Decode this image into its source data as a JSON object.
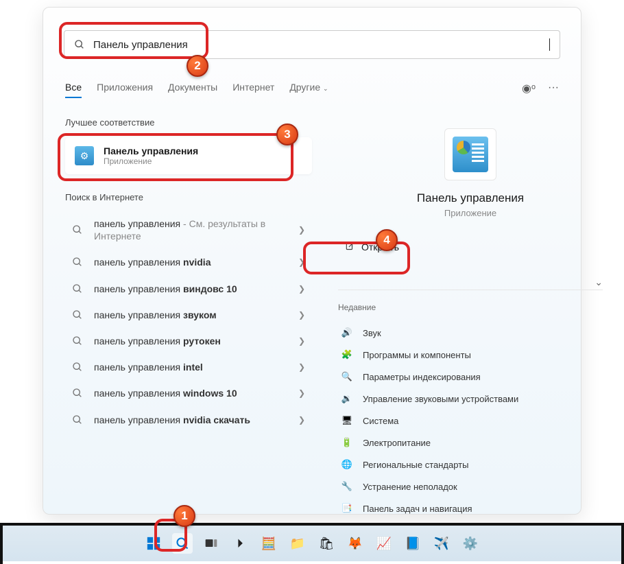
{
  "search": {
    "value": "Панель управления"
  },
  "tabs": {
    "all": "Все",
    "apps": "Приложения",
    "docs": "Документы",
    "web": "Интернет",
    "more": "Другие"
  },
  "left": {
    "best_label": "Лучшее соответствие",
    "best_title": "Панель управления",
    "best_sub": "Приложение",
    "web_label": "Поиск в Интернете",
    "items": [
      {
        "pre": "панель управления",
        "hl": "",
        "sub": " - См. результаты в Интернете"
      },
      {
        "pre": "панель управления ",
        "hl": "nvidia",
        "sub": ""
      },
      {
        "pre": "панель управления ",
        "hl": "виндовс 10",
        "sub": ""
      },
      {
        "pre": "панель управления ",
        "hl": "звуком",
        "sub": ""
      },
      {
        "pre": "панель управления ",
        "hl": "рутокен",
        "sub": ""
      },
      {
        "pre": "панель управления ",
        "hl": "intel",
        "sub": ""
      },
      {
        "pre": "панель управления ",
        "hl": "windows 10",
        "sub": ""
      },
      {
        "pre": "панель управления ",
        "hl": "nvidia скачать",
        "sub": ""
      }
    ]
  },
  "right": {
    "title": "Панель управления",
    "sub": "Приложение",
    "open": "Открыть",
    "recent_label": "Недавние",
    "recent": [
      {
        "icon": "🔊",
        "label": "Звук"
      },
      {
        "icon": "🧩",
        "label": "Программы и компоненты"
      },
      {
        "icon": "🔍",
        "label": "Параметры индексирования"
      },
      {
        "icon": "🔉",
        "label": "Управление звуковыми устройствами"
      },
      {
        "icon": "🖥",
        "label": "Система"
      },
      {
        "icon": "🔋",
        "label": "Электропитание"
      },
      {
        "icon": "🌐",
        "label": "Региональные стандарты"
      },
      {
        "icon": "🔧",
        "label": "Устранение неполадок"
      },
      {
        "icon": "📑",
        "label": "Панель задач и навигация"
      }
    ]
  },
  "badges": {
    "b1": "1",
    "b2": "2",
    "b3": "3",
    "b4": "4"
  }
}
